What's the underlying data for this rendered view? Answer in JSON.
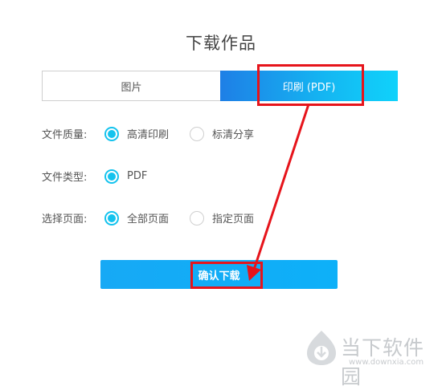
{
  "dialog": {
    "title": "下载作品",
    "tabs": [
      {
        "label": "图片",
        "active": false
      },
      {
        "label": "印刷 (PDF)",
        "active": true
      }
    ],
    "quality": {
      "label": "文件质量:",
      "options": [
        {
          "label": "高清印刷",
          "checked": true
        },
        {
          "label": "标清分享",
          "checked": false
        }
      ]
    },
    "filetype": {
      "label": "文件类型:",
      "options": [
        {
          "label": "PDF",
          "checked": true
        }
      ]
    },
    "pages": {
      "label": "选择页面:",
      "options": [
        {
          "label": "全部页面",
          "checked": true
        },
        {
          "label": "指定页面",
          "checked": false
        }
      ]
    },
    "confirm_label": "确认下载"
  },
  "annotation": {
    "highlight_color": "#e6141b"
  },
  "watermark": {
    "text": "当下软件园",
    "url": "www.downxia.com"
  },
  "colors": {
    "accent": "#14c3ee",
    "button": "#0db0f8"
  }
}
